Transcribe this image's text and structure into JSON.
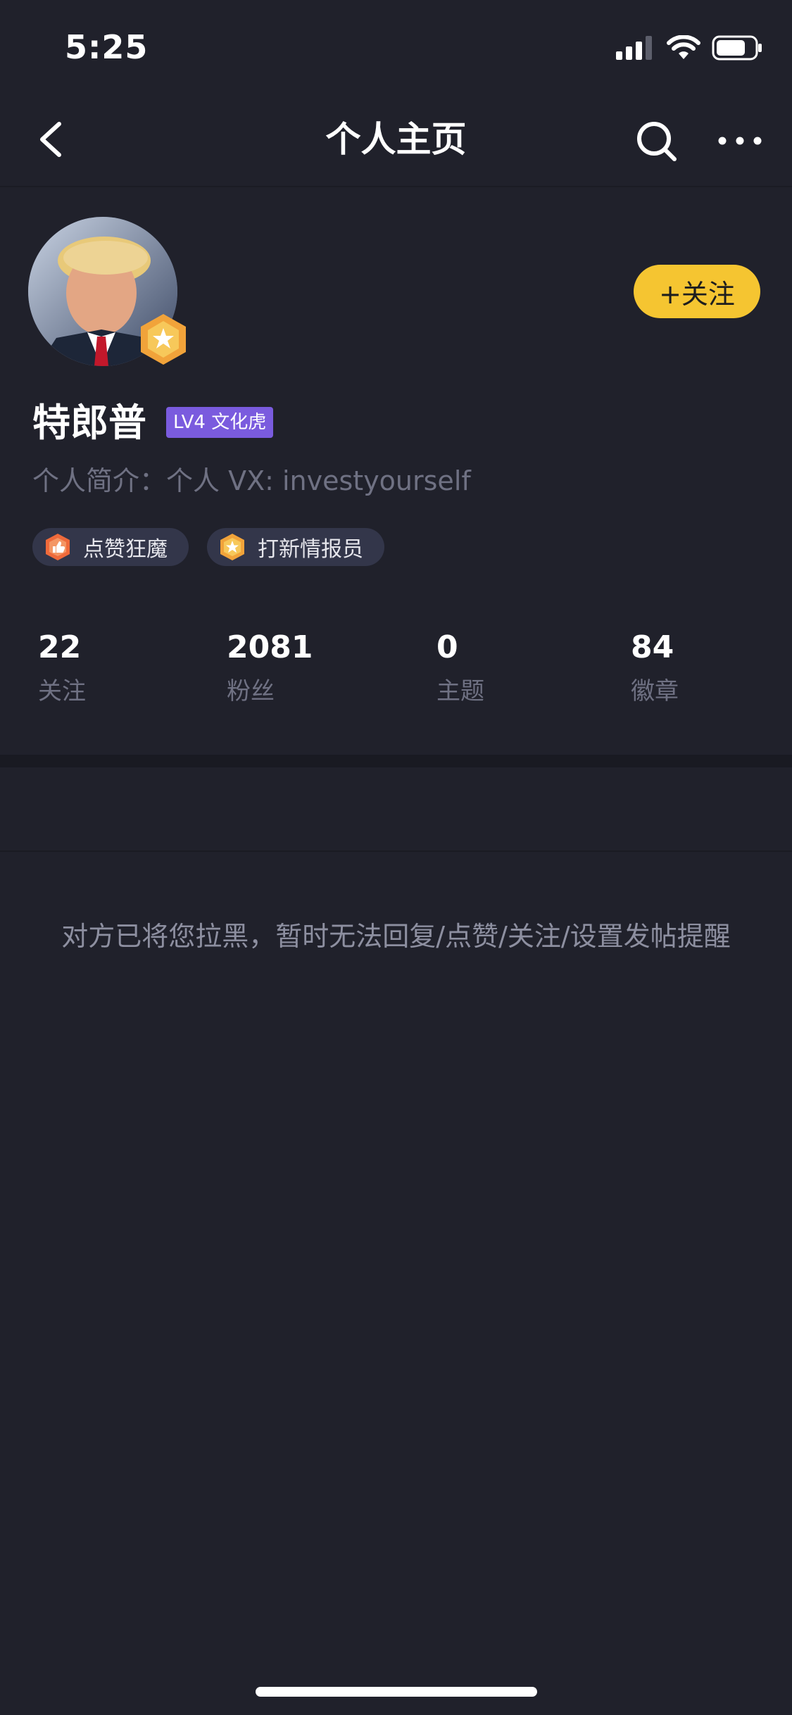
{
  "status_bar": {
    "time": "5:25",
    "icons": [
      "signal-icon",
      "wifi-icon",
      "battery-icon"
    ]
  },
  "nav": {
    "title": "个人主页",
    "icons": [
      "back-icon",
      "search-icon",
      "more-icon"
    ]
  },
  "profile": {
    "name": "特郎普",
    "level_badge": "LV4 文化虎",
    "bio": "个人简介：个人 VX: investyourself",
    "follow_label": "+关注",
    "tags": [
      {
        "label": "点赞狂魔",
        "icon": "like-medal-icon"
      },
      {
        "label": "打新情报员",
        "icon": "star-medal-icon"
      }
    ]
  },
  "stats": [
    {
      "value": "22",
      "label": "关注"
    },
    {
      "value": "2081",
      "label": "粉丝"
    },
    {
      "value": "0",
      "label": "主题"
    },
    {
      "value": "84",
      "label": "徽章"
    }
  ],
  "blocked_message": "对方已将您拉黑，暂时无法回复/点赞/关注/设置发帖提醒",
  "colors": {
    "background": "#20212b",
    "accent": "#f5c531",
    "level_badge": "#7a5bde",
    "tag_background": "#33364a",
    "muted_text": "#6f7183"
  }
}
